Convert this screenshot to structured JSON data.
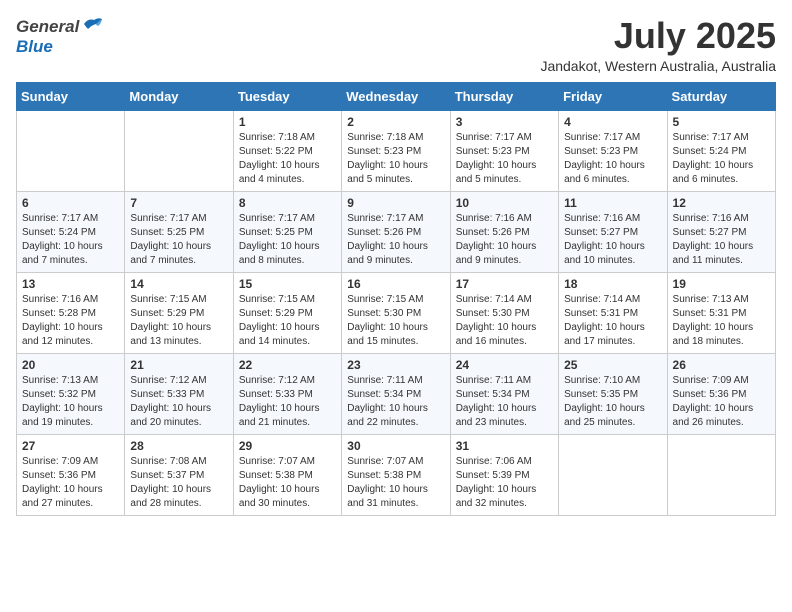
{
  "header": {
    "logo_general": "General",
    "logo_blue": "Blue",
    "month_title": "July 2025",
    "location": "Jandakot, Western Australia, Australia"
  },
  "days_of_week": [
    "Sunday",
    "Monday",
    "Tuesday",
    "Wednesday",
    "Thursday",
    "Friday",
    "Saturday"
  ],
  "weeks": [
    [
      {
        "day": "",
        "info": ""
      },
      {
        "day": "",
        "info": ""
      },
      {
        "day": "1",
        "info": "Sunrise: 7:18 AM\nSunset: 5:22 PM\nDaylight: 10 hours and 4 minutes."
      },
      {
        "day": "2",
        "info": "Sunrise: 7:18 AM\nSunset: 5:23 PM\nDaylight: 10 hours and 5 minutes."
      },
      {
        "day": "3",
        "info": "Sunrise: 7:17 AM\nSunset: 5:23 PM\nDaylight: 10 hours and 5 minutes."
      },
      {
        "day": "4",
        "info": "Sunrise: 7:17 AM\nSunset: 5:23 PM\nDaylight: 10 hours and 6 minutes."
      },
      {
        "day": "5",
        "info": "Sunrise: 7:17 AM\nSunset: 5:24 PM\nDaylight: 10 hours and 6 minutes."
      }
    ],
    [
      {
        "day": "6",
        "info": "Sunrise: 7:17 AM\nSunset: 5:24 PM\nDaylight: 10 hours and 7 minutes."
      },
      {
        "day": "7",
        "info": "Sunrise: 7:17 AM\nSunset: 5:25 PM\nDaylight: 10 hours and 7 minutes."
      },
      {
        "day": "8",
        "info": "Sunrise: 7:17 AM\nSunset: 5:25 PM\nDaylight: 10 hours and 8 minutes."
      },
      {
        "day": "9",
        "info": "Sunrise: 7:17 AM\nSunset: 5:26 PM\nDaylight: 10 hours and 9 minutes."
      },
      {
        "day": "10",
        "info": "Sunrise: 7:16 AM\nSunset: 5:26 PM\nDaylight: 10 hours and 9 minutes."
      },
      {
        "day": "11",
        "info": "Sunrise: 7:16 AM\nSunset: 5:27 PM\nDaylight: 10 hours and 10 minutes."
      },
      {
        "day": "12",
        "info": "Sunrise: 7:16 AM\nSunset: 5:27 PM\nDaylight: 10 hours and 11 minutes."
      }
    ],
    [
      {
        "day": "13",
        "info": "Sunrise: 7:16 AM\nSunset: 5:28 PM\nDaylight: 10 hours and 12 minutes."
      },
      {
        "day": "14",
        "info": "Sunrise: 7:15 AM\nSunset: 5:29 PM\nDaylight: 10 hours and 13 minutes."
      },
      {
        "day": "15",
        "info": "Sunrise: 7:15 AM\nSunset: 5:29 PM\nDaylight: 10 hours and 14 minutes."
      },
      {
        "day": "16",
        "info": "Sunrise: 7:15 AM\nSunset: 5:30 PM\nDaylight: 10 hours and 15 minutes."
      },
      {
        "day": "17",
        "info": "Sunrise: 7:14 AM\nSunset: 5:30 PM\nDaylight: 10 hours and 16 minutes."
      },
      {
        "day": "18",
        "info": "Sunrise: 7:14 AM\nSunset: 5:31 PM\nDaylight: 10 hours and 17 minutes."
      },
      {
        "day": "19",
        "info": "Sunrise: 7:13 AM\nSunset: 5:31 PM\nDaylight: 10 hours and 18 minutes."
      }
    ],
    [
      {
        "day": "20",
        "info": "Sunrise: 7:13 AM\nSunset: 5:32 PM\nDaylight: 10 hours and 19 minutes."
      },
      {
        "day": "21",
        "info": "Sunrise: 7:12 AM\nSunset: 5:33 PM\nDaylight: 10 hours and 20 minutes."
      },
      {
        "day": "22",
        "info": "Sunrise: 7:12 AM\nSunset: 5:33 PM\nDaylight: 10 hours and 21 minutes."
      },
      {
        "day": "23",
        "info": "Sunrise: 7:11 AM\nSunset: 5:34 PM\nDaylight: 10 hours and 22 minutes."
      },
      {
        "day": "24",
        "info": "Sunrise: 7:11 AM\nSunset: 5:34 PM\nDaylight: 10 hours and 23 minutes."
      },
      {
        "day": "25",
        "info": "Sunrise: 7:10 AM\nSunset: 5:35 PM\nDaylight: 10 hours and 25 minutes."
      },
      {
        "day": "26",
        "info": "Sunrise: 7:09 AM\nSunset: 5:36 PM\nDaylight: 10 hours and 26 minutes."
      }
    ],
    [
      {
        "day": "27",
        "info": "Sunrise: 7:09 AM\nSunset: 5:36 PM\nDaylight: 10 hours and 27 minutes."
      },
      {
        "day": "28",
        "info": "Sunrise: 7:08 AM\nSunset: 5:37 PM\nDaylight: 10 hours and 28 minutes."
      },
      {
        "day": "29",
        "info": "Sunrise: 7:07 AM\nSunset: 5:38 PM\nDaylight: 10 hours and 30 minutes."
      },
      {
        "day": "30",
        "info": "Sunrise: 7:07 AM\nSunset: 5:38 PM\nDaylight: 10 hours and 31 minutes."
      },
      {
        "day": "31",
        "info": "Sunrise: 7:06 AM\nSunset: 5:39 PM\nDaylight: 10 hours and 32 minutes."
      },
      {
        "day": "",
        "info": ""
      },
      {
        "day": "",
        "info": ""
      }
    ]
  ]
}
